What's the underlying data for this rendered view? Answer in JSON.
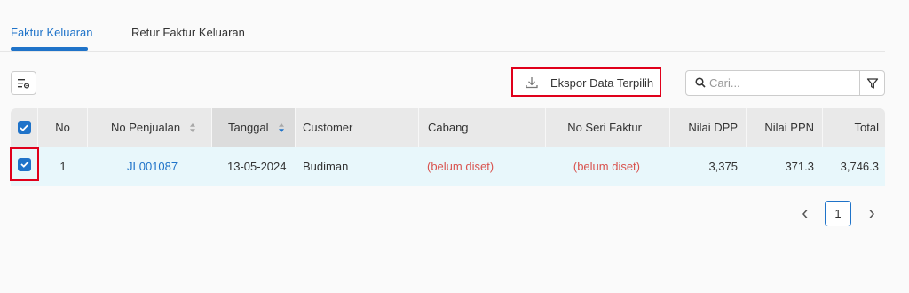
{
  "tabs": [
    {
      "label": "Faktur Keluaran",
      "active": true
    },
    {
      "label": "Retur Faktur Keluaran",
      "active": false
    }
  ],
  "toolbar": {
    "column_settings_icon": "column-settings-icon",
    "export_label": "Ekspor Data Terpilih",
    "search_placeholder": "Cari...",
    "search_value": ""
  },
  "table": {
    "columns": {
      "no": "No",
      "no_penjualan": "No Penjualan",
      "tanggal": "Tanggal",
      "customer": "Customer",
      "cabang": "Cabang",
      "no_seri_faktur": "No Seri Faktur",
      "nilai_dpp": "Nilai DPP",
      "nilai_ppn": "Nilai PPN",
      "total": "Total"
    },
    "rows": [
      {
        "checked": true,
        "no": "1",
        "no_penjualan": "JL001087",
        "tanggal": "13-05-2024",
        "customer": "Budiman",
        "cabang": "(belum diset)",
        "no_seri_faktur": "(belum diset)",
        "nilai_dpp": "3,375",
        "nilai_ppn": "371.3",
        "total": "3,746.3"
      }
    ]
  },
  "pagination": {
    "current_page": "1"
  },
  "colors": {
    "accent": "#1f73c9",
    "highlight_border": "#e0001b",
    "row_selected_bg": "#e8f7fb",
    "unset_text": "#d9534f"
  }
}
